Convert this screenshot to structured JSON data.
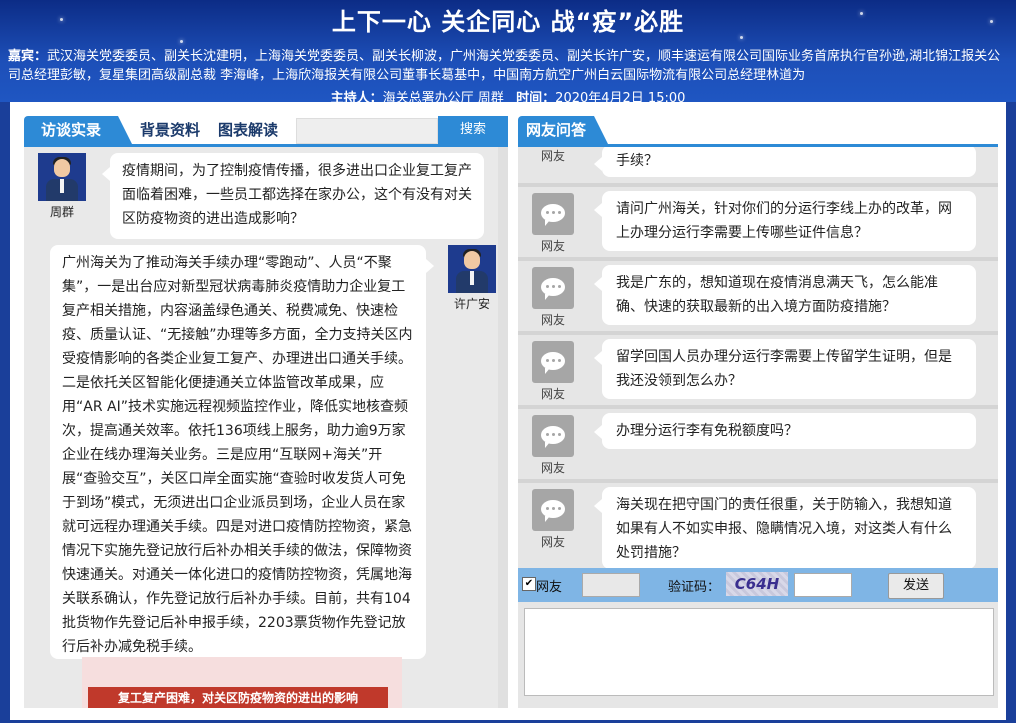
{
  "header": {
    "title": "上下一心 关企同心 战“疫”必胜",
    "guests_label": "嘉宾：",
    "guests_text": "武汉海关党委委员、副关长沈建明，上海海关党委委员、副关长柳波，广州海关党委委员、副关长许广安，顺丰速运有限公司国际业务首席执行官孙逊,湖北锦江报关公司总经理彭敏，复星集团高级副总裁 李海峰，上海欣海报关有限公司董事长葛基中，中国南方航空广州白云国际物流有限公司总经理林道为",
    "host_label": "主持人：",
    "host_name": "海关总署办公厅 周群",
    "time_label": "时间：",
    "time_value": "2020年4月2日 15:00"
  },
  "left_panel": {
    "tabs": [
      {
        "label": "访谈实录",
        "active": true
      },
      {
        "label": "背景资料",
        "active": false
      },
      {
        "label": "图表解读",
        "active": false
      }
    ],
    "search_label": "搜索",
    "messages": [
      {
        "speaker": "周群",
        "text": "疫情期间，为了控制疫情传播，很多进出口企业复工复产面临着困难，一些员工都选择在家办公，这个有没有对关区防疫物资的进出造成影响？"
      },
      {
        "speaker": "许广安",
        "text": "广州海关为了推动海关手续办理“零跑动”、人员“不聚集”，一是出台应对新型冠状病毒肺炎疫情助力企业复工复产相关措施，内容涵盖绿色通关、税费减免、快速检疫、质量认证、“无接触”办理等多方面，全力支持关区内受疫情影响的各类企业复工复产、办理进出口通关手续。二是依托关区智能化便捷通关立体监管改革成果，应用“AR AI”技术实施远程视频监控作业，降低实地核查频次，提高通关效率。依托136项线上服务，助力逾9万家企业在线办理海关业务。三是应用“互联网+海关”开展“查验交互”，关区口岸全面实施“查验时收发货人可免于到场”模式，无须进出口企业派员到场，企业人员在家就可远程办理通关手续。四是对进口疫情防控物资，紧急情况下实施先登记放行后补办相关手续的做法，保障物资快速通关。对通关一体化进口的疫情防控物资，凭属地海关联系确认，作先登记放行后补办手续。目前，共有104批货物作先登记后补申报手续，2203票货物作先登记放行后补办减免税手续。"
      }
    ],
    "infographic_caption": "复工复产困难，对关区防疫物资的进出的影响"
  },
  "right_panel": {
    "tab_label": "网友问答",
    "questions": [
      {
        "user": "网友",
        "text": "手续？"
      },
      {
        "user": "网友",
        "text": "请问广州海关，针对你们的分运行李线上办的改革，网上办理分运行李需要上传哪些证件信息？"
      },
      {
        "user": "网友",
        "text": "我是广东的，想知道现在疫情消息满天飞，怎么能准确、快速的获取最新的出入境方面防疫措施？"
      },
      {
        "user": "网友",
        "text": "留学回国人员办理分运行李需要上传留学生证明，但是我还没领到怎么办？"
      },
      {
        "user": "网友",
        "text": "办理分运行李有免税额度吗？"
      },
      {
        "user": "网友",
        "text": "海关现在把守国门的责任很重，关于防输入，我想知道如果有人不如实申报、隐瞒情况入境，对这类人有什么处罚措施？"
      }
    ],
    "form": {
      "netizen_label": "网友",
      "captcha_label": "验证码：",
      "captcha_text": "C64H",
      "send_label": "发送"
    }
  }
}
